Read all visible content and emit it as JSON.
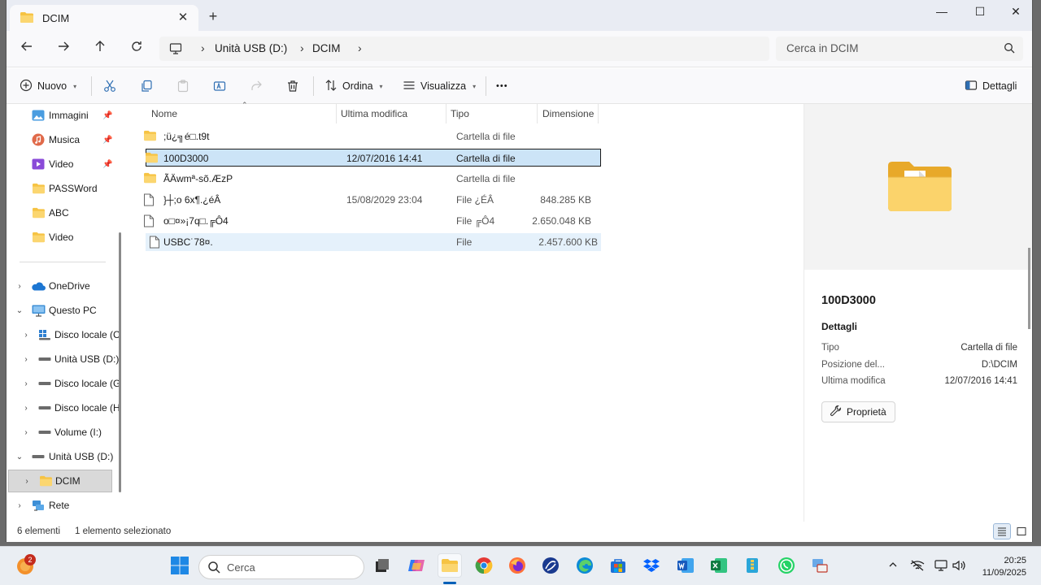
{
  "tab": {
    "title": "DCIM",
    "close_glyph": "✕",
    "new_glyph": "+"
  },
  "window_controls": {
    "minimize": "—",
    "maximize": "☐",
    "close": "✕"
  },
  "breadcrumb": {
    "items": [
      "Unità USB (D:)",
      "DCIM"
    ],
    "separator": "›"
  },
  "search": {
    "placeholder": "Cerca in DCIM"
  },
  "commands": {
    "new": "Nuovo",
    "sort": "Ordina",
    "view": "Visualizza",
    "more": "•••",
    "details": "Dettagli"
  },
  "sidebar": {
    "quick_access": [
      {
        "label": "Immagini",
        "icon": "pictures-icon",
        "pinned": true
      },
      {
        "label": "Musica",
        "icon": "music-icon",
        "pinned": true
      },
      {
        "label": "Video",
        "icon": "videos-icon",
        "pinned": true
      },
      {
        "label": "PASSWord",
        "icon": "folder-icon",
        "pinned": false
      },
      {
        "label": "ABC",
        "icon": "folder-icon",
        "pinned": false
      },
      {
        "label": "Video",
        "icon": "folder-icon",
        "pinned": false
      }
    ],
    "tree": [
      {
        "label": "OneDrive",
        "icon": "onedrive-icon",
        "expanded": false,
        "level": 0
      },
      {
        "label": "Questo PC",
        "icon": "pc-icon",
        "expanded": true,
        "level": 0
      },
      {
        "label": "Disco locale (C",
        "icon": "windows-drive-icon",
        "expanded": false,
        "level": 1
      },
      {
        "label": "Unità USB (D:)",
        "icon": "drive-icon",
        "expanded": false,
        "level": 1
      },
      {
        "label": "Disco locale (G",
        "icon": "drive-icon",
        "expanded": false,
        "level": 1
      },
      {
        "label": "Disco locale (H",
        "icon": "drive-icon",
        "expanded": false,
        "level": 1
      },
      {
        "label": "Volume (I:)",
        "icon": "drive-icon",
        "expanded": false,
        "level": 1
      },
      {
        "label": "Unità USB (D:)",
        "icon": "drive-icon",
        "expanded": true,
        "level": 0
      },
      {
        "label": "DCIM",
        "icon": "folder-icon",
        "expanded": false,
        "level": 1,
        "selected": true
      },
      {
        "label": "Rete",
        "icon": "network-icon",
        "expanded": false,
        "level": 0
      }
    ]
  },
  "columns": {
    "name": "Nome",
    "modified": "Ultima modifica",
    "type": "Tipo",
    "size": "Dimensione"
  },
  "files": [
    {
      "name": ";ü¿╗é□.t9t",
      "modified": "",
      "type": "Cartella di file",
      "size": "",
      "kind": "folder"
    },
    {
      "name": "100D3000",
      "modified": "12/07/2016 14:41",
      "type": "Cartella di file",
      "size": "",
      "kind": "folder",
      "selected": true
    },
    {
      "name": "ÃÄwmª-sõ.ÆzP",
      "modified": "",
      "type": "Cartella di file",
      "size": "",
      "kind": "folder"
    },
    {
      "name": "}┼;o 6x¶.¿éÂ",
      "modified": "15/08/2029 23:04",
      "type": "File ¿ÉÂ",
      "size": "848.285 KB",
      "kind": "file"
    },
    {
      "name": "o□¤»¡7q□.╔Ô4",
      "modified": "",
      "type": "File ╔Ô4",
      "size": "2.650.048 KB",
      "kind": "file"
    },
    {
      "name": "USBC˙78¤.",
      "modified": "",
      "type": "File",
      "size": "2.457.600 KB",
      "kind": "file",
      "hover": true
    }
  ],
  "details_pane": {
    "title": "100D3000",
    "section": "Dettagli",
    "props": [
      {
        "key": "Tipo",
        "value": "Cartella di file"
      },
      {
        "key": "Posizione del...",
        "value": "D:\\DCIM"
      },
      {
        "key": "Ultima modifica",
        "value": "12/07/2016 14:41"
      }
    ],
    "properties_button": "Proprietà"
  },
  "status": {
    "count": "6 elementi",
    "selection": "1 elemento selezionato"
  },
  "taskbar": {
    "search_placeholder": "Cerca",
    "notification_badge": "2",
    "clock_time": "20:25",
    "clock_date": "11/09/2025"
  },
  "colors": {
    "accent": "#005fb8",
    "folder": "#f6c343",
    "selection": "#cce4f7"
  }
}
